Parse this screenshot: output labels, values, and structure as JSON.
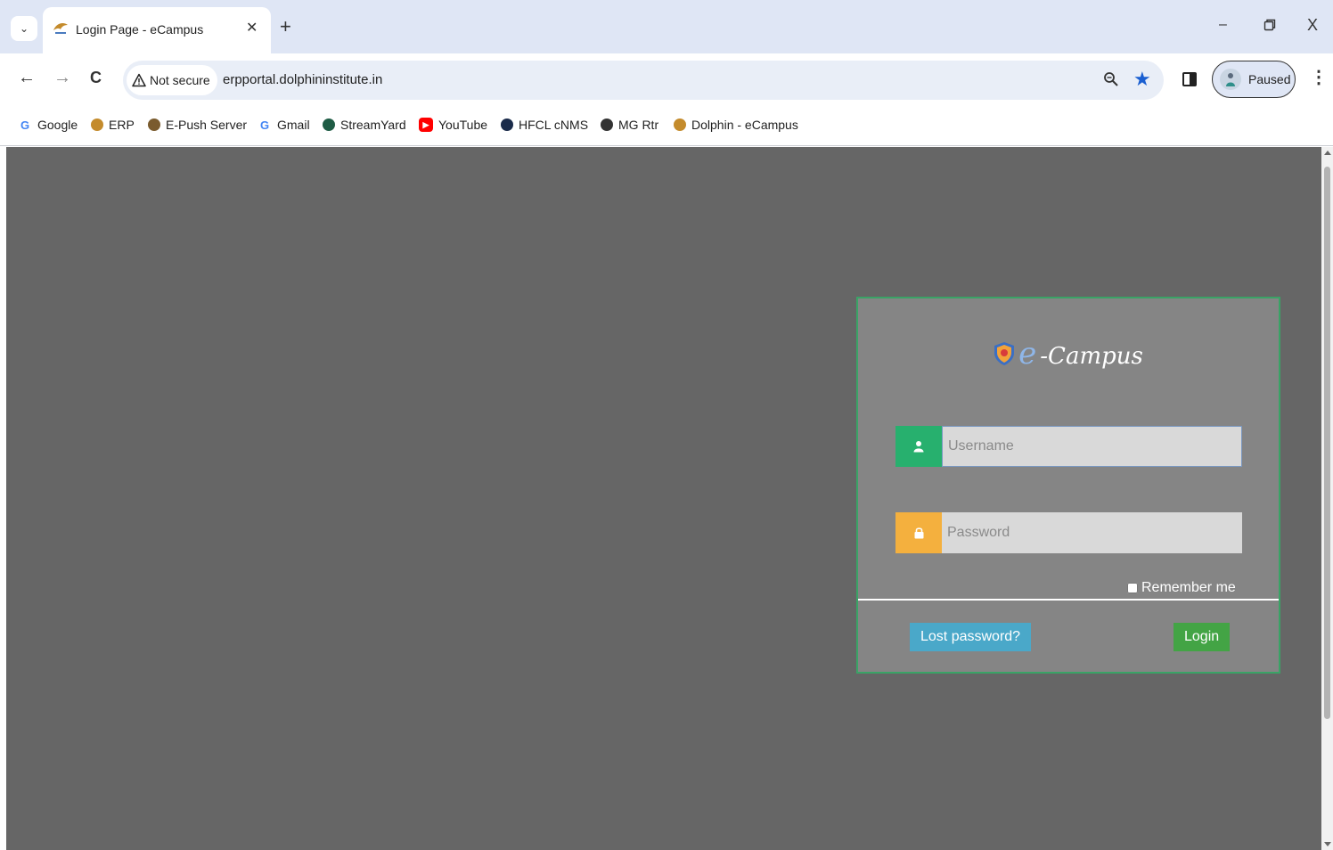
{
  "browser": {
    "tab": {
      "title": "Login Page - eCampus"
    },
    "window": {
      "minimize": "–",
      "close": "X"
    },
    "nav": {
      "back": "←",
      "forward": "→",
      "reload": "C"
    },
    "security_chip": "Not secure",
    "url": "erpportal.dolphininstitute.in",
    "profile_label": "Paused",
    "bookmarks": [
      {
        "label": "Google",
        "icon": "google-icon",
        "glyph": "G",
        "color": "#4285f4"
      },
      {
        "label": "ERP",
        "icon": "erp-icon",
        "glyph": "",
        "color": "#c48b2c"
      },
      {
        "label": "E-Push Server",
        "icon": "e-push-icon",
        "glyph": "",
        "color": "#7a5b2e"
      },
      {
        "label": "Gmail",
        "icon": "gmail-google-icon",
        "glyph": "G",
        "color": "#4285f4"
      },
      {
        "label": "StreamYard",
        "icon": "streamyard-icon",
        "glyph": "",
        "color": "#1f5c45"
      },
      {
        "label": "YouTube",
        "icon": "youtube-icon",
        "glyph": "▶",
        "color": "#ff0000"
      },
      {
        "label": "HFCL cNMS",
        "icon": "hfcl-icon",
        "glyph": "",
        "color": "#1a2b4a"
      },
      {
        "label": "MG Rtr",
        "icon": "globe-icon",
        "glyph": "",
        "color": "#333333"
      },
      {
        "label": "Dolphin - eCampus",
        "icon": "dolphin-icon",
        "glyph": "",
        "color": "#c48b2c"
      }
    ]
  },
  "login": {
    "brand_e": "e",
    "brand_rest": "-Campus",
    "username_placeholder": "Username",
    "password_placeholder": "Password",
    "remember_label": "Remember me",
    "lost_password": "Lost password?",
    "login": "Login",
    "colors": {
      "username_icon_bg": "#27b06e",
      "password_icon_bg": "#f4b03e",
      "border": "#3aa366"
    }
  }
}
